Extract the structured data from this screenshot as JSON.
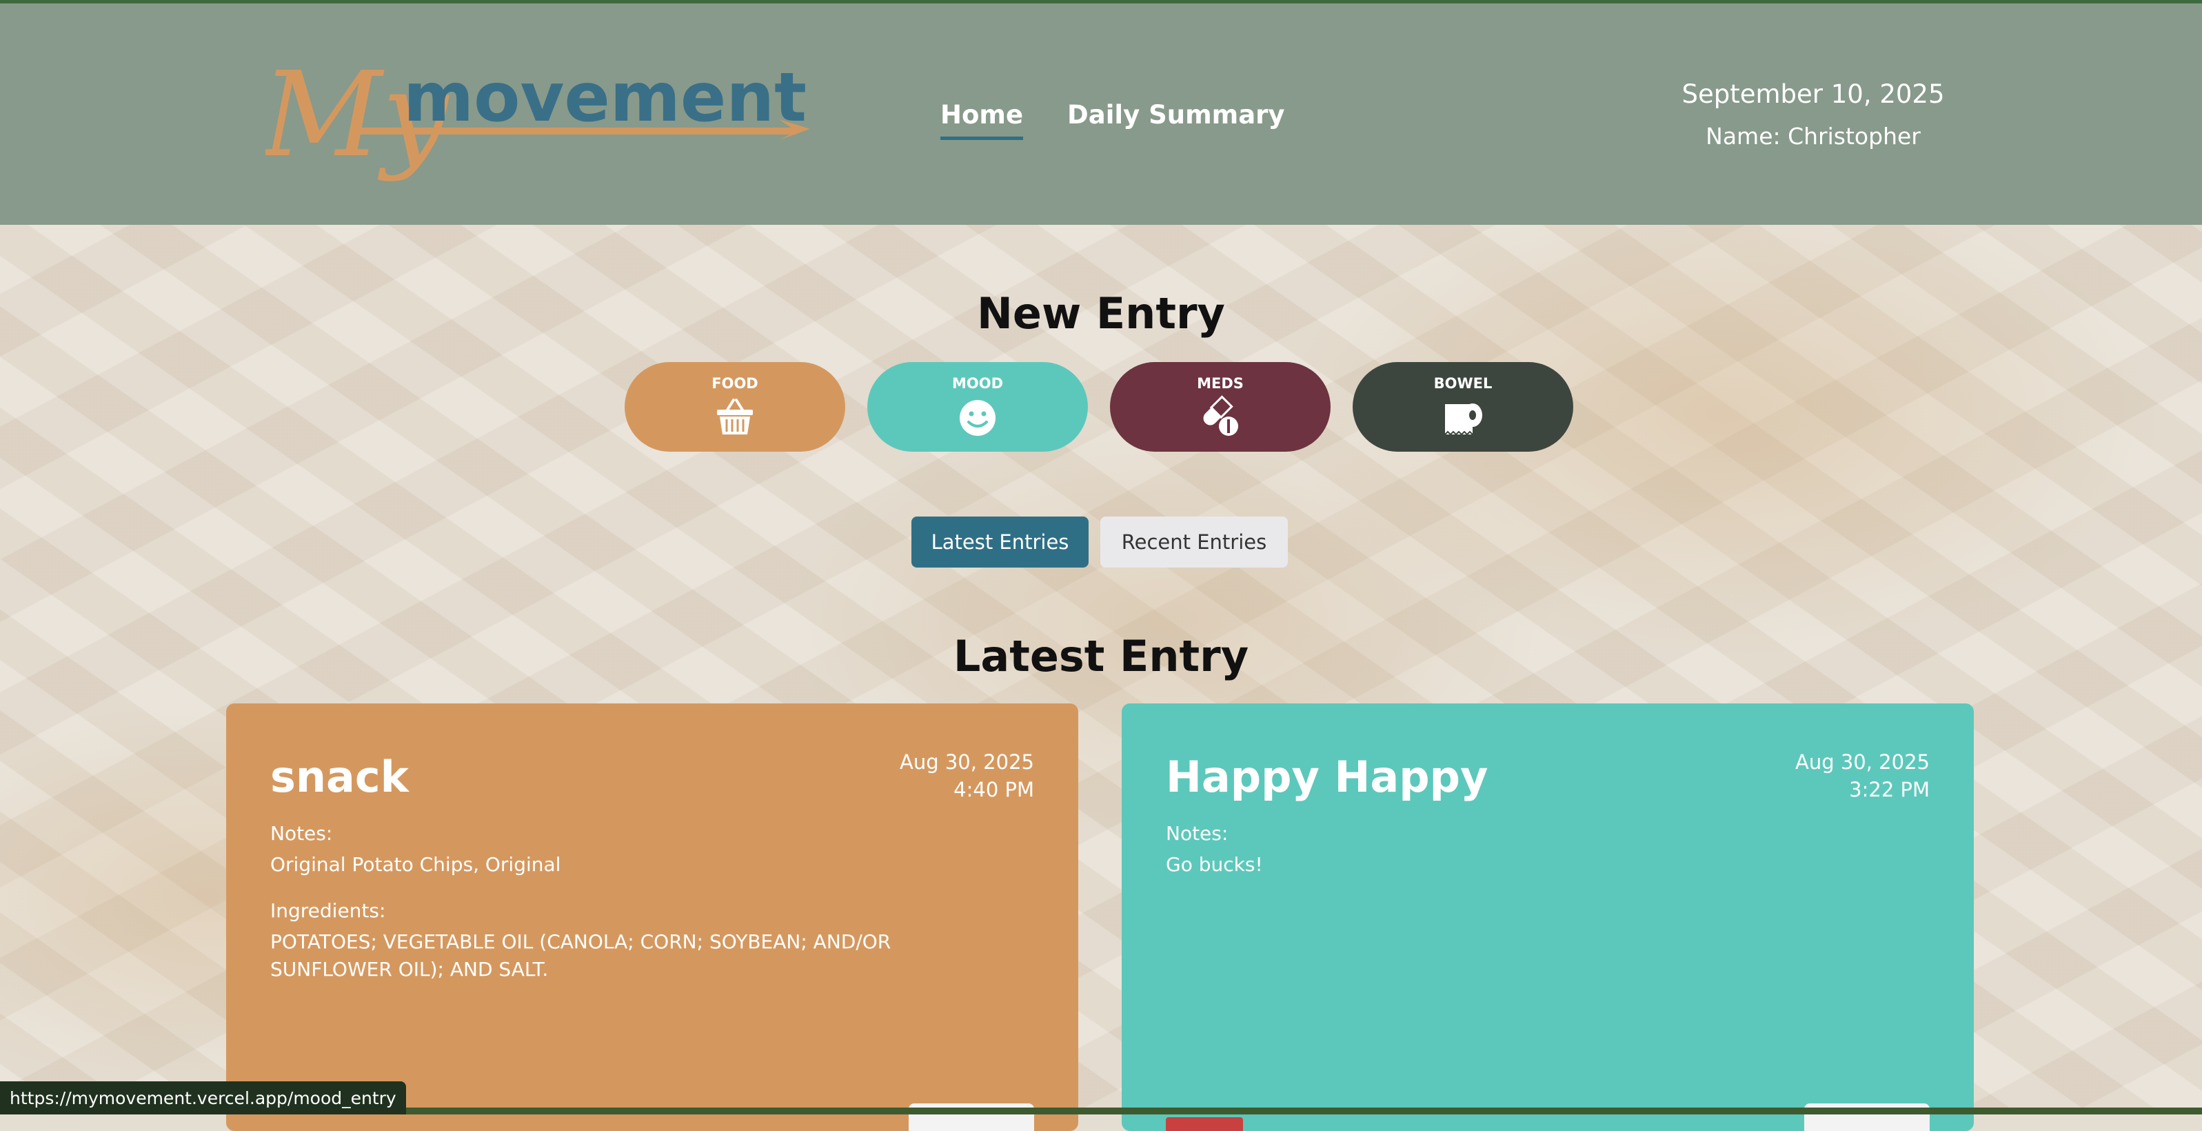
{
  "header": {
    "logo_my": "My",
    "logo_movement": "movement",
    "nav": [
      {
        "label": "Home",
        "active": true
      },
      {
        "label": "Daily Summary",
        "active": false
      }
    ],
    "date": "September 10, 2025",
    "name": "Name: Christopher"
  },
  "new_entry": {
    "title": "New Entry",
    "buttons": [
      {
        "label": "FOOD",
        "icon": "basket-icon",
        "color": "#d4985f"
      },
      {
        "label": "MOOD",
        "icon": "smiley-icon",
        "color": "#5cc8bb"
      },
      {
        "label": "MEDS",
        "icon": "pill-icon",
        "color": "#6d3340"
      },
      {
        "label": "BOWEL",
        "icon": "toilet-paper-icon",
        "color": "#3d463e"
      }
    ]
  },
  "tabs": [
    {
      "label": "Latest Entries",
      "active": true
    },
    {
      "label": "Recent Entries",
      "active": false
    }
  ],
  "latest": {
    "title": "Latest Entry",
    "cards": [
      {
        "title": "snack",
        "date": "Aug 30, 2025",
        "time": "4:40 PM",
        "notes_label": "Notes:",
        "notes": "Original Potato Chips, Original",
        "ingredients_label": "Ingredients:",
        "ingredients": "POTATOES; VEGETABLE OIL (CANOLA; CORN; SOYBEAN; AND/OR SUNFLOWER OIL); AND SALT.",
        "color": "#d4985f"
      },
      {
        "title": "Happy Happy",
        "date": "Aug 30, 2025",
        "time": "3:22 PM",
        "notes_label": "Notes:",
        "notes": "Go bucks!",
        "color": "#5cc8bb"
      }
    ]
  },
  "status_url": "https://mymovement.vercel.app/mood_entry",
  "colors": {
    "header_bg": "#889a8b",
    "accent_blue": "#2f6f86",
    "logo_orange": "#d4985f",
    "logo_blue": "#3a6f88"
  }
}
